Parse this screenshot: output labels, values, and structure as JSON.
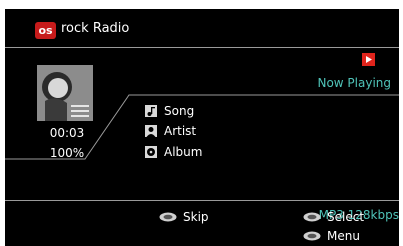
{
  "header": {
    "logo_text": "os",
    "station": "rock Radio"
  },
  "status": {
    "now_playing": "Now Playing",
    "elapsed": "00:03",
    "volume": "100%",
    "bitrate": "MP3 128kbps"
  },
  "track_info": {
    "song": "Song",
    "artist": "Artist",
    "album": "Album"
  },
  "controls": {
    "skip": "Skip",
    "select": "Select",
    "menu": "Menu"
  },
  "colors": {
    "accent": "#4fc3b8",
    "brand": "#c71b1b",
    "background": "#000000"
  },
  "icons": {
    "play": "play-icon",
    "song": "music-note-icon",
    "artist": "person-icon",
    "album": "disc-icon",
    "button": "remote-button-icon"
  }
}
